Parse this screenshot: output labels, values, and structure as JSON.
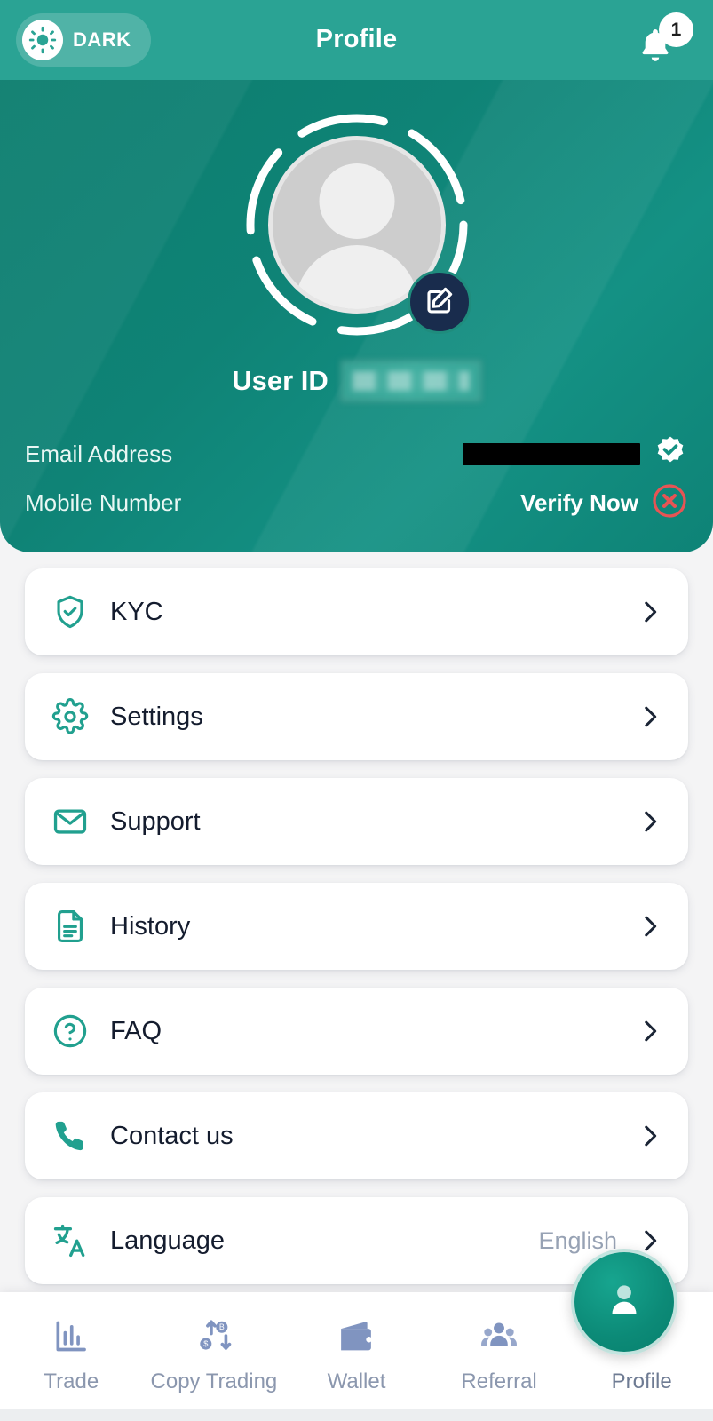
{
  "topbar": {
    "theme_toggle": {
      "label": "DARK",
      "icon": "sun-icon"
    },
    "title": "Profile",
    "notification": {
      "icon": "bell-icon",
      "badge_count": "1"
    }
  },
  "hero": {
    "avatar": {
      "icon": "user-avatar-placeholder",
      "edit_icon": "edit-pencil-icon"
    },
    "user_id": {
      "label": "User ID",
      "value": "",
      "redacted": true
    },
    "email": {
      "label": "Email Address",
      "value": "",
      "redacted": true,
      "status": "verified",
      "status_icon": "verified-badge-check-icon"
    },
    "mobile": {
      "label": "Mobile Number",
      "action_label": "Verify Now",
      "status": "unverified",
      "status_icon": "error-circle-x-icon"
    }
  },
  "menu": {
    "items": [
      {
        "label": "KYC",
        "icon": "shield-check-icon",
        "value": "",
        "chevron": "chevron-right-icon"
      },
      {
        "label": "Settings",
        "icon": "gear-icon",
        "value": "",
        "chevron": "chevron-right-icon"
      },
      {
        "label": "Support",
        "icon": "envelope-icon",
        "value": "",
        "chevron": "chevron-right-icon"
      },
      {
        "label": "History",
        "icon": "document-lines-icon",
        "value": "",
        "chevron": "chevron-right-icon"
      },
      {
        "label": "FAQ",
        "icon": "question-circle-icon",
        "value": "",
        "chevron": "chevron-right-icon"
      },
      {
        "label": "Contact us",
        "icon": "phone-icon",
        "value": "",
        "chevron": "chevron-right-icon"
      },
      {
        "label": "Language",
        "icon": "translate-icon",
        "value": "English",
        "chevron": "chevron-right-icon"
      }
    ]
  },
  "bottom_nav": {
    "items": [
      {
        "label": "Trade",
        "icon": "bar-chart-icon",
        "active": false
      },
      {
        "label": "Copy Trading",
        "icon": "copy-trading-arrows-icon",
        "active": false
      },
      {
        "label": "Wallet",
        "icon": "wallet-icon",
        "active": false
      },
      {
        "label": "Referral",
        "icon": "people-group-icon",
        "active": false
      },
      {
        "label": "Profile",
        "icon": "person-icon",
        "active": true
      }
    ],
    "fab_icon": "person-filled-icon"
  },
  "colors": {
    "topbar_teal": "#2aa394",
    "hero_teal": "#0f8376",
    "accent_teal": "#1f9182",
    "icon_teal": "#21a08f",
    "dark_navy": "#192c4d",
    "nav_icon_blue": "#8094c0",
    "muted_text": "#97a2b4",
    "danger_red": "#e85454",
    "page_bg": "#f4f4f5"
  }
}
